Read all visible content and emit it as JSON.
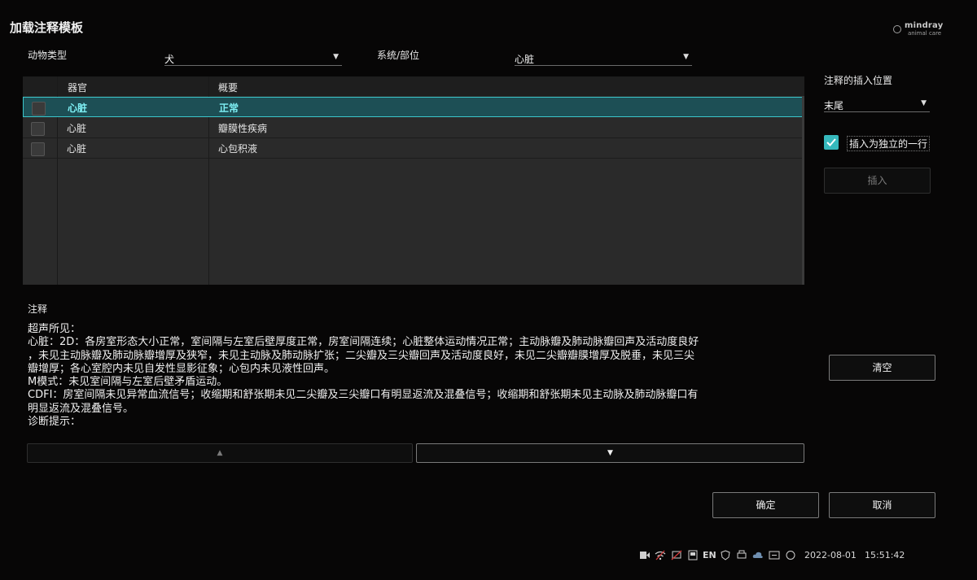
{
  "window": {
    "title": "加载注释模板"
  },
  "logo": {
    "brand": "mindray",
    "sub": "animal care"
  },
  "filters": {
    "animal_label": "动物类型",
    "animal_value": "犬",
    "system_label": "系统/部位",
    "system_value": "心脏"
  },
  "table": {
    "headers": [
      "器官",
      "概要"
    ],
    "rows": [
      {
        "organ": "心脏",
        "summary": "正常",
        "selected": true
      },
      {
        "organ": "心脏",
        "summary": "瓣膜性疾病",
        "selected": false
      },
      {
        "organ": "心脏",
        "summary": "心包积液",
        "selected": false
      }
    ]
  },
  "insert_panel": {
    "position_label": "注释的插入位置",
    "position_value": "末尾",
    "standalone_label": "插入为独立的一行",
    "standalone_checked": true,
    "insert_button": "插入"
  },
  "notes": {
    "label": "注释",
    "lines": [
      "超声所见：",
      "心脏：2D：各房室形态大小正常，室间隔与左室后壁厚度正常，房室间隔连续；心脏整体运动情况正常；主动脉瓣及肺动脉瓣回声及活动度良好",
      "，未见主动脉瓣及肺动脉瓣增厚及狭窄，未见主动脉及肺动脉扩张；二尖瓣及三尖瓣回声及活动度良好，未见二尖瓣瓣膜增厚及脱垂，未见三尖",
      "瓣增厚；各心室腔内未见自发性显影征象；心包内未见液性回声。",
      "M模式：未见室间隔与左室后壁矛盾运动。",
      "CDFI：房室间隔未见异常血流信号；收缩期和舒张期未见二尖瓣及三尖瓣口有明显返流及混叠信号；收缩期和舒张期未见主动脉及肺动脉瓣口有",
      "明显返流及混叠信号。",
      "诊断提示："
    ],
    "clear_button": "清空",
    "scroll_up": "▲",
    "scroll_down": "▼"
  },
  "buttons": {
    "ok": "确定",
    "cancel": "取消"
  },
  "status_bar": {
    "lang": "EN",
    "date": "2022-08-01",
    "time": "15:51:42"
  }
}
